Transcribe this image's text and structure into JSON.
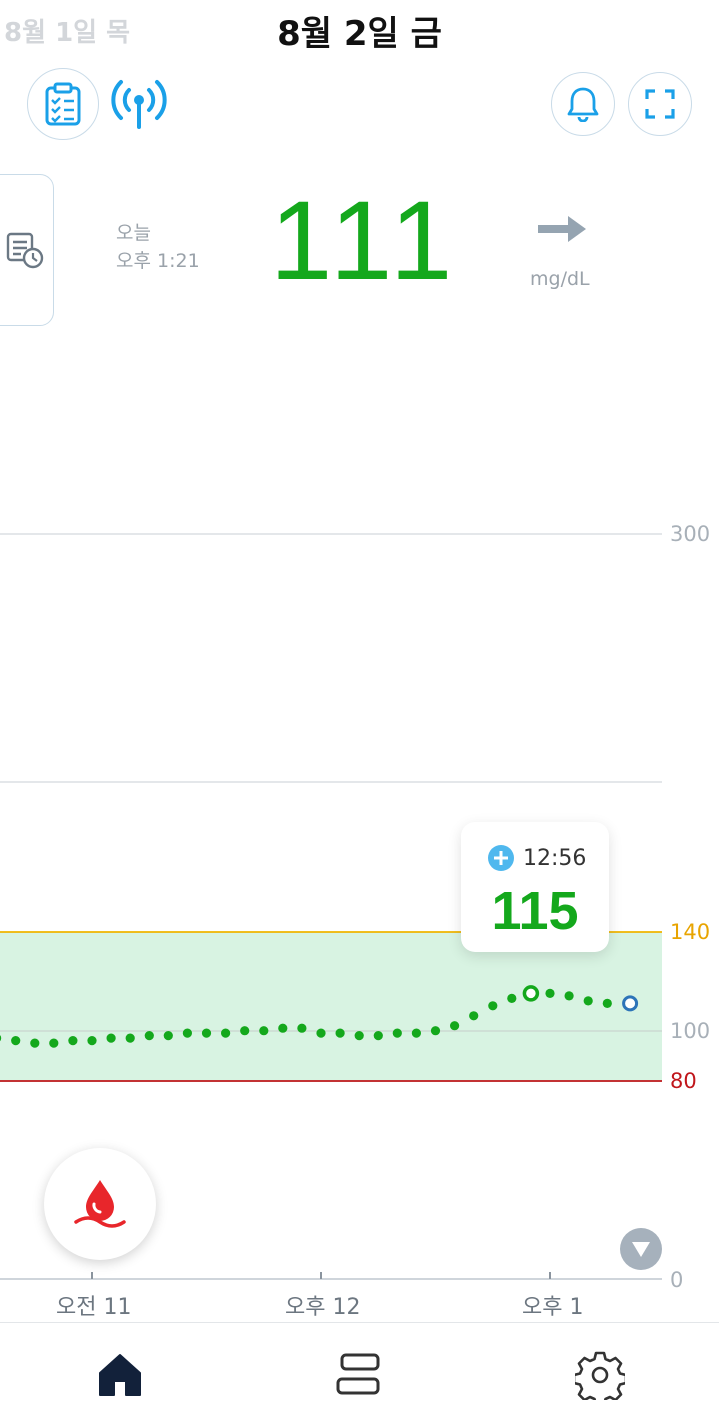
{
  "header": {
    "prev_date": "8월 1일 목",
    "current_date": "8월 2일 금"
  },
  "icons": {
    "report": "clipboard-checklist-icon",
    "signal": "wireless-signal-icon",
    "alarm": "bell-icon",
    "fullscreen": "fullscreen-icon",
    "history": "history-log-icon",
    "trend": "arrow-right-icon",
    "blood": "blood-drop-icon",
    "scroll_down": "triangle-down-icon",
    "home": "home-icon",
    "list": "list-view-icon",
    "settings": "gear-icon"
  },
  "reading": {
    "day": "오늘",
    "time": "오후 1:21",
    "value": "111",
    "unit": "mg/dL",
    "trend": "steady"
  },
  "tooltip": {
    "time": "12:56",
    "value": "115"
  },
  "colors": {
    "in_range": "#14a81c",
    "high_line": "#f0b400",
    "low_line": "#c0161b",
    "target_band": "#d8f3e2",
    "accent_blue": "#1aa0e8",
    "current_point": "#2d74b8"
  },
  "chart_data": {
    "type": "scatter",
    "x_ticks": [
      "오전 11",
      "오후 12",
      "오후 1"
    ],
    "y_ticks": [
      "300",
      "140",
      "100",
      "80",
      "0"
    ],
    "ylim": [
      0,
      300
    ],
    "target_range": [
      80,
      140
    ],
    "high_threshold": 140,
    "low_threshold": 80,
    "time_range": [
      "10:35",
      "13:21"
    ],
    "series": [
      {
        "x": [
          "10:35",
          "10:40",
          "10:45",
          "10:50",
          "10:55",
          "11:00",
          "11:05",
          "11:10",
          "11:15",
          "11:20",
          "11:25",
          "11:30",
          "11:35",
          "11:40",
          "11:45",
          "11:50",
          "11:55",
          "12:00",
          "12:05",
          "12:10",
          "12:15",
          "12:20",
          "12:25",
          "12:30",
          "12:35",
          "12:40",
          "12:45",
          "12:50",
          "12:55",
          "13:00",
          "13:05",
          "13:10",
          "13:15",
          "13:21"
        ],
        "values": [
          97,
          96,
          95,
          95,
          96,
          96,
          97,
          97,
          98,
          98,
          99,
          99,
          99,
          100,
          100,
          101,
          101,
          99,
          99,
          98,
          98,
          99,
          99,
          100,
          102,
          106,
          110,
          113,
          115,
          115,
          114,
          112,
          111,
          111
        ],
        "highlight_index": 28,
        "current_index": 33
      }
    ]
  }
}
